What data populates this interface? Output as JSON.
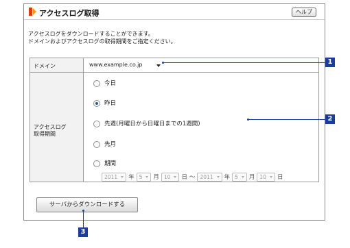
{
  "header": {
    "title": "アクセスログ取得",
    "help_label": "ヘルプ"
  },
  "description": {
    "line1": "アクセスログをダウンロードすることができます。",
    "line2": "ドメインおよびアクセスログの取得期間をご指定ください。"
  },
  "form": {
    "domain_label": "ドメイン",
    "domain_value": "www.example.co.jp",
    "period_label_line1": "アクセスログ",
    "period_label_line2": "取得期間",
    "options": [
      "今日",
      "昨日",
      "先週(月曜日から日曜日までの1週間)",
      "先月",
      "期間"
    ],
    "selected_option": "昨日",
    "range": {
      "from_year": "2011",
      "from_month": "5",
      "from_day": "10",
      "to_year": "2011",
      "to_month": "5",
      "to_day": "10",
      "year_unit": "年",
      "month_unit": "月",
      "day_unit": "日",
      "separator": "〜"
    }
  },
  "download_button_label": "サーバからダウンロードする",
  "callouts": [
    "1",
    "2",
    "3"
  ],
  "colors": {
    "callout": "#1b3e9a",
    "header_mark_red": "#e03a12",
    "header_mark_orange": "#f39a1a"
  }
}
